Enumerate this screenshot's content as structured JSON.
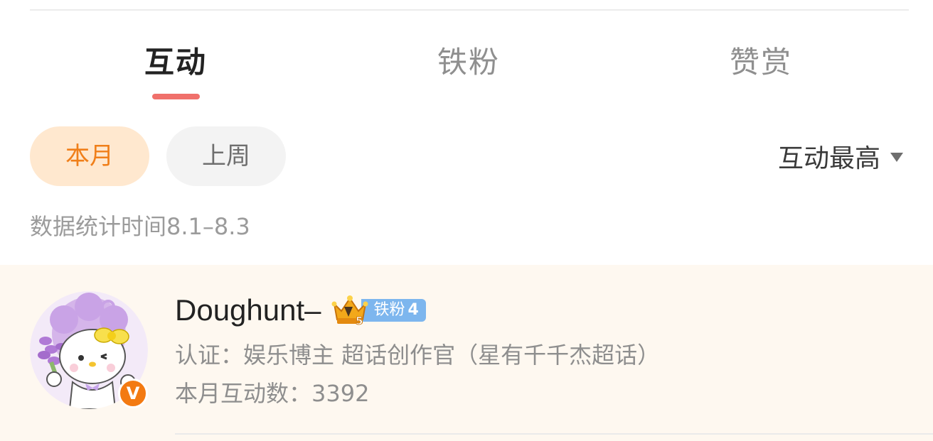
{
  "tabs": [
    {
      "label": "互动",
      "active": true
    },
    {
      "label": "铁粉",
      "active": false
    },
    {
      "label": "赞赏",
      "active": false
    }
  ],
  "period_filters": [
    {
      "label": "本月",
      "selected": true
    },
    {
      "label": "上周",
      "selected": false
    }
  ],
  "sort": {
    "label": "互动最高",
    "icon": "caret-down-icon"
  },
  "stats_period": "数据统计时间8.1–8.3",
  "users": [
    {
      "username": "Doughunt–",
      "badge": {
        "icon": "crown-icon",
        "crown_level": "5",
        "label": "铁粉",
        "level": "4"
      },
      "verified_icon": "verified-v-icon",
      "verified_mark": "V",
      "certification": "认证：娱乐博主 超话创作官（星有千千杰超话）",
      "interaction_count": "本月互动数：3392"
    }
  ],
  "colors": {
    "accent_tab_underline": "#f0706b",
    "selected_pill_bg": "#ffe8cf",
    "selected_pill_text": "#f07f1a",
    "fan_tag": "#7db6ee",
    "verify_badge": "#f37a12",
    "row_highlight": "#fef8f0"
  }
}
